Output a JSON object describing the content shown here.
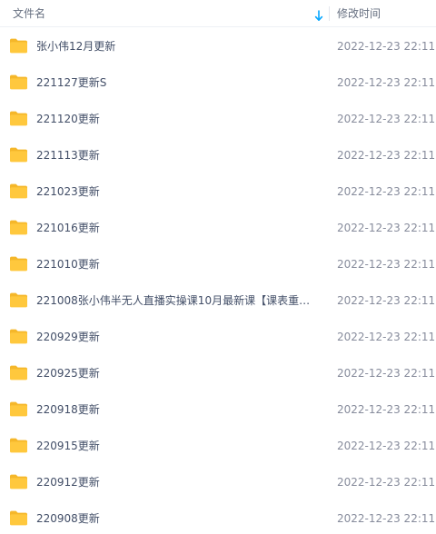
{
  "header": {
    "name_label": "文件名",
    "modified_label": "修改时间",
    "sort_icon": "arrow-down-icon"
  },
  "colors": {
    "folder": "#ffc83d",
    "folder_back": "#f5b72a",
    "sort_accent": "#06a7ff",
    "name_text": "#424e67",
    "date_text": "#878c9c"
  },
  "files": [
    {
      "icon": "folder-icon",
      "name": "张小伟12月更新",
      "modified": "2022-12-23 22:11"
    },
    {
      "icon": "folder-icon",
      "name": "221127更新S",
      "modified": "2022-12-23 22:11"
    },
    {
      "icon": "folder-icon",
      "name": "221120更新",
      "modified": "2022-12-23 22:11"
    },
    {
      "icon": "folder-icon",
      "name": "221113更新",
      "modified": "2022-12-23 22:11"
    },
    {
      "icon": "folder-icon",
      "name": "221023更新",
      "modified": "2022-12-23 22:11"
    },
    {
      "icon": "folder-icon",
      "name": "221016更新",
      "modified": "2022-12-23 22:11"
    },
    {
      "icon": "folder-icon",
      "name": "221010更新",
      "modified": "2022-12-23 22:11"
    },
    {
      "icon": "folder-icon",
      "name": "221008张小伟半无人直播实操课10月最新课【课表重新…",
      "modified": "2022-12-23 22:11"
    },
    {
      "icon": "folder-icon",
      "name": "220929更新",
      "modified": "2022-12-23 22:11"
    },
    {
      "icon": "folder-icon",
      "name": "220925更新",
      "modified": "2022-12-23 22:11"
    },
    {
      "icon": "folder-icon",
      "name": "220918更新",
      "modified": "2022-12-23 22:11"
    },
    {
      "icon": "folder-icon",
      "name": "220915更新",
      "modified": "2022-12-23 22:11"
    },
    {
      "icon": "folder-icon",
      "name": "220912更新",
      "modified": "2022-12-23 22:11"
    },
    {
      "icon": "folder-icon",
      "name": "220908更新",
      "modified": "2022-12-23 22:11"
    }
  ]
}
